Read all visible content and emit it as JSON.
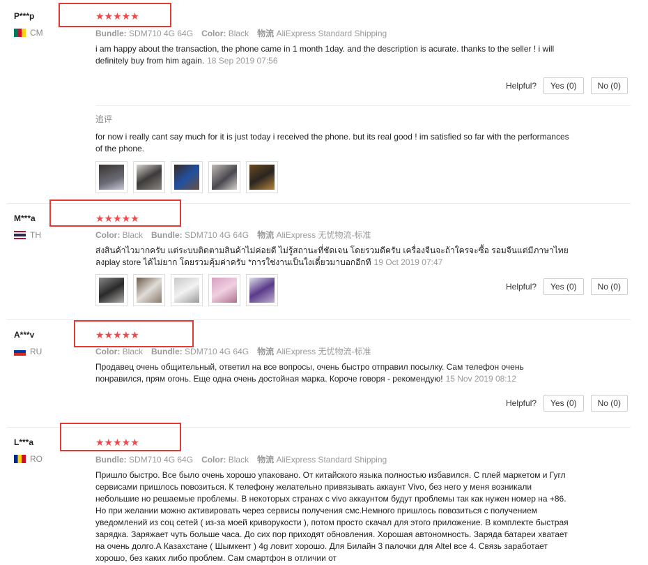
{
  "reviews": [
    {
      "user": "P***p",
      "country": "CM",
      "stars": "★★★★★",
      "meta": {
        "k1": "Bundle:",
        "v1": "SDM710 4G 64G",
        "k2": "Color:",
        "v2": "Black",
        "k3": "物流",
        "v3": "AliExpress Standard Shipping"
      },
      "text": "i am happy about the transaction, the phone came in 1 month 1day. and the description is acurate. thanks to the seller ! i will definitely buy from him again.",
      "date": "18 Sep 2019 07:56",
      "helpful_label": "Helpful?",
      "yes": "Yes (0)",
      "no": "No (0)",
      "addon_label": "追评",
      "addon_text": "for now i really cant say much for it is just today i received the phone. but its real good ! im satisfied so far with the performances of the phone."
    },
    {
      "user": "M***a",
      "country": "TH",
      "stars": "★★★★★",
      "meta": {
        "k1": "Color:",
        "v1": "Black",
        "k2": "Bundle:",
        "v2": "SDM710 4G 64G",
        "k3": "物流",
        "v3": "AliExpress 无忧物流-标准"
      },
      "text": "ส่งสินค้าไวมากครับ แต่ระบบติดตามสินค้าไม่ค่อยดี ไม่รู้สถานะที่ชัดเจน โดยรวมดีครับ เครื่องจีนจะถ้าใครจะซื้อ รอมจีนแต่มีภาษาไทย ลงplay store ได้ไม่ยาก โดยรวมคุ้มค่าครับ *การใช่งานเป็นใงเดี๋ยวมาบอกอีกที",
      "date": "19 Oct 2019 07:47",
      "helpful_label": "Helpful?",
      "yes": "Yes (0)",
      "no": "No (0)"
    },
    {
      "user": "A***v",
      "country": "RU",
      "stars": "★★★★★",
      "meta": {
        "k1": "Color:",
        "v1": "Black",
        "k2": "Bundle:",
        "v2": "SDM710 4G 64G",
        "k3": "物流",
        "v3": "AliExpress 无忧物流-标准"
      },
      "text": "Продавец очень общительный, ответил на все вопросы, очень быстро отправил посылку. Сам телефон очень понравился, прям огонь. Еще одна очень достойная марка. Короче говоря - рекомендую!",
      "date": "15 Nov 2019 08:12",
      "helpful_label": "Helpful?",
      "yes": "Yes (0)",
      "no": "No (0)"
    },
    {
      "user": "L***a",
      "country": "RO",
      "stars": "★★★★★",
      "meta": {
        "k1": "Bundle:",
        "v1": "SDM710 4G 64G",
        "k2": "Color:",
        "v2": "Black",
        "k3": "物流",
        "v3": "AliExpress Standard Shipping"
      },
      "text": "Пришло быстро. Все было очень хорошо упаковано. От китайского языка полностью избавился. С плей маркетом и Гугл сервисами пришлось повозиться. К телефону желательно привязывать аккаунт Vivo, без него у меня возникали небольшие но решаемые проблемы. В некоторых странах с vivo аккаунтом будут проблемы так как нужен номер на +86. Но при желании можно активировать через сервисы получения смс.Немного пришлось повозиться с получением уведомлений из соц сетей ( из-за моей криворукости ), потом просто скачал для этого приложение. В комплекте быстрая зарядка. Заряжает чуть больше часа. До сих пор приходят обновления. Хорошая автономность. Заряда батареи хватает на очень долго.А Казахстане ( Шымкент ) 4g ловит хорошо. Для Билайн 3 палочки для Altel все 4. Связь заработает хорошо, без каких либо проблем. Сам смартфон в отличии от"
    }
  ],
  "colors": {
    "star": "#f04848",
    "highlight": "#e53935"
  }
}
